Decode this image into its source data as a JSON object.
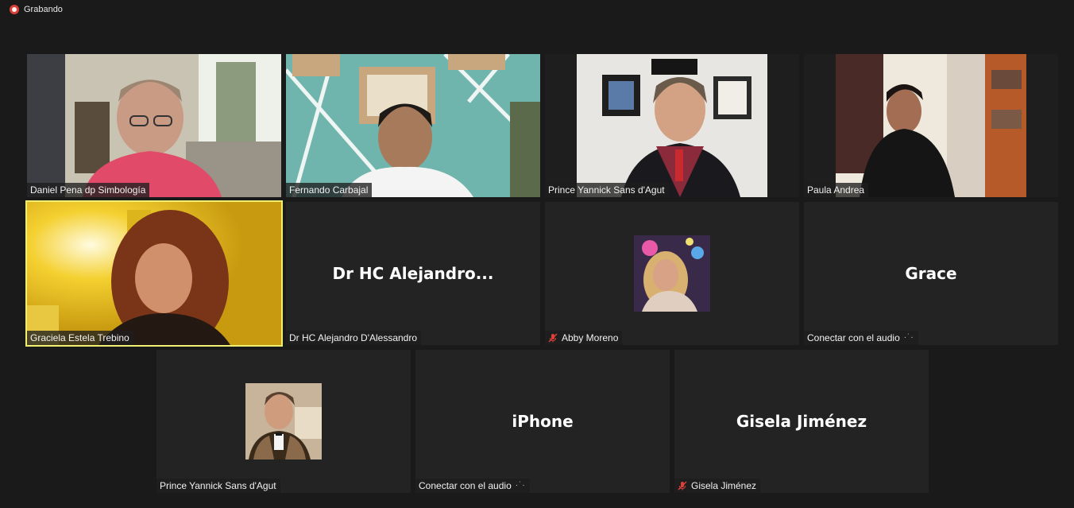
{
  "recording": {
    "label": "Grabando"
  },
  "participants": [
    {
      "name": "Daniel Pena dp Simbología"
    },
    {
      "name": "Fernando Carbajal"
    },
    {
      "name": "Prince Yannick Sans d'Agut"
    },
    {
      "name": "Paula Andrea"
    },
    {
      "name": "Graciela Estela Trebino"
    },
    {
      "name": "Dr HC Alejandro D'Alessandro",
      "display": "Dr HC Alejandro..."
    },
    {
      "name": "Abby Moreno"
    },
    {
      "name": "Grace",
      "display": "Grace",
      "status": "Conectar con el audio"
    },
    {
      "name": "Prince Yannick Sans d'Agut"
    },
    {
      "name": "iPhone",
      "display": "iPhone",
      "status": "Conectar con el audio"
    },
    {
      "name": "Gisela Jiménez",
      "display": "Gisela Jiménez"
    }
  ],
  "colors": {
    "background": "#1a1a1a",
    "tile": "#232323",
    "active_speaker": "#f0ef72",
    "recording": "#d8403a",
    "muted": "#e0403a"
  },
  "icons": {
    "muted": "microphone-muted-icon",
    "connecting": "audio-connecting-icon",
    "recording": "recording-dot-icon"
  }
}
